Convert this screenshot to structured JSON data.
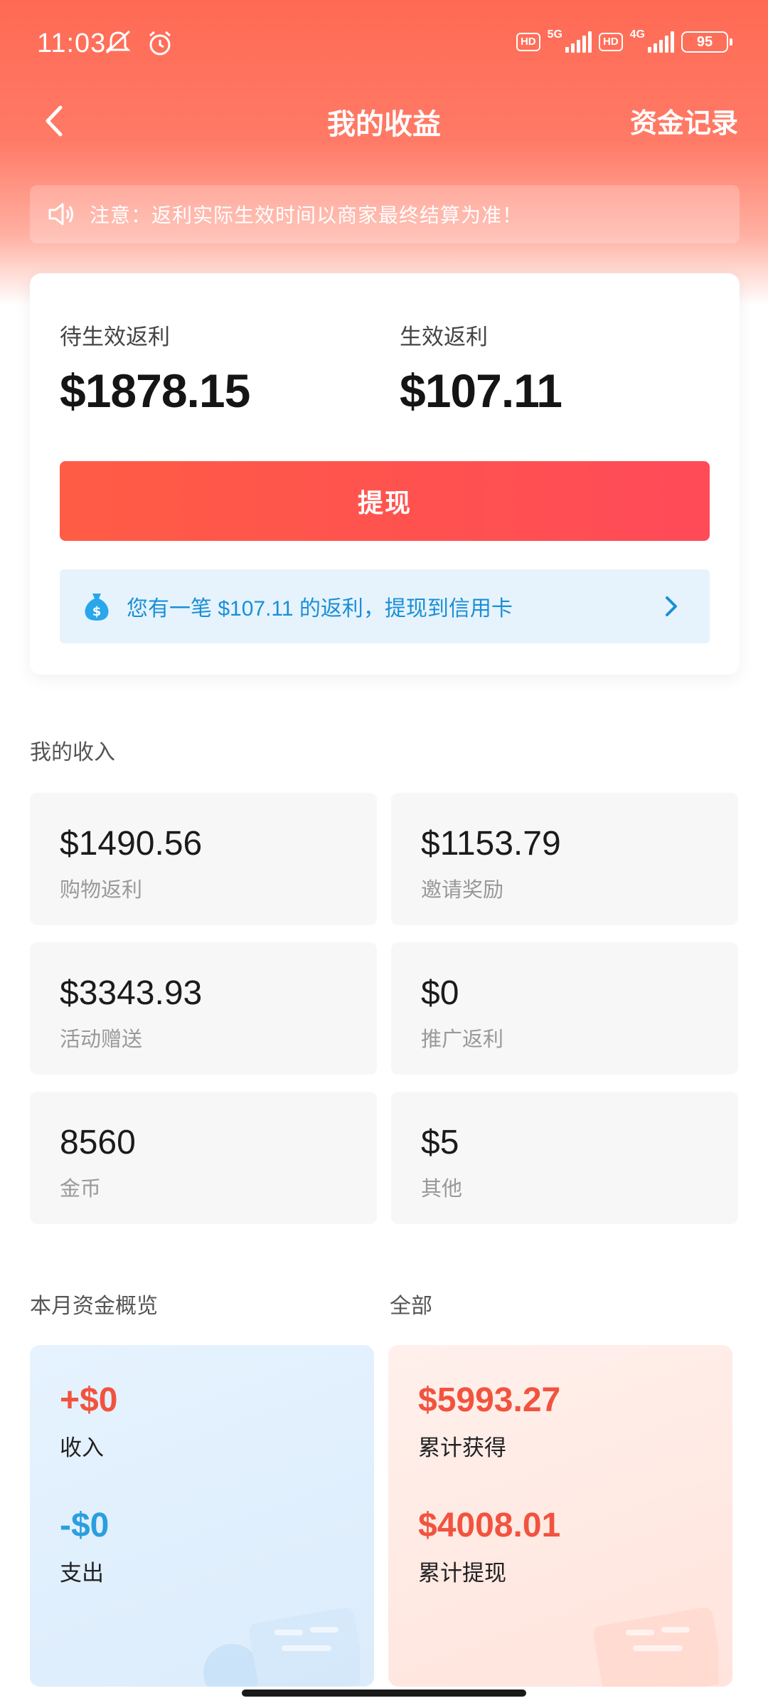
{
  "status_bar": {
    "time": "11:03",
    "net1": "5G",
    "net2": "4G",
    "hd": "HD",
    "battery": "95"
  },
  "header": {
    "title": "我的收益",
    "records": "资金记录"
  },
  "notice": {
    "text": "注意：返利实际生效时间以商家最终结算为准！"
  },
  "balance": {
    "pending_label": "待生效返利",
    "pending_value": "$1878.15",
    "effective_label": "生效返利",
    "effective_value": "$107.11",
    "withdraw_label": "提现",
    "promo_text": "您有一笔 $107.11 的返利，提现到信用卡"
  },
  "income": {
    "title": "我的收入",
    "items": [
      {
        "value": "$1490.56",
        "label": "购物返利"
      },
      {
        "value": "$1153.79",
        "label": "邀请奖励"
      },
      {
        "value": "$3343.93",
        "label": "活动赠送"
      },
      {
        "value": "$0",
        "label": "推广返利"
      },
      {
        "value": "8560",
        "label": "金币"
      },
      {
        "value": "$5",
        "label": "其他"
      }
    ]
  },
  "overview": {
    "month_title": "本月资金概览",
    "all_title": "全部",
    "month_income_value": "+$0",
    "month_income_label": "收入",
    "month_expense_value": "-$0",
    "month_expense_label": "支出",
    "total_earned_value": "$5993.27",
    "total_earned_label": "累计获得",
    "total_withdrawn_value": "$4008.01",
    "total_withdrawn_label": "累计提现"
  },
  "colors": {
    "accent_red": "#f2533e",
    "accent_blue": "#2a9fe0",
    "header_bg": "#ff6a54"
  }
}
